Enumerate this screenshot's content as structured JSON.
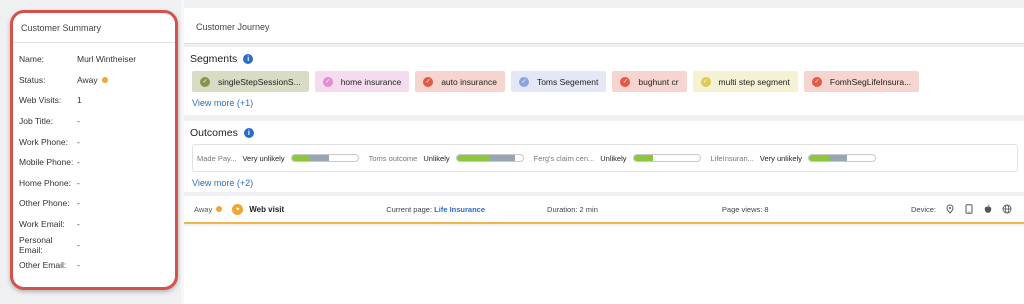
{
  "summary": {
    "title": "Customer Summary",
    "rows": [
      {
        "label": "Name:",
        "value": "Murl Wintheiser"
      },
      {
        "label": "Status:",
        "value": "Away"
      },
      {
        "label": "Web Visits:",
        "value": "1"
      },
      {
        "label": "Job Title:",
        "value": "-"
      },
      {
        "label": "Work Phone:",
        "value": "-"
      },
      {
        "label": "Mobile Phone:",
        "value": "-"
      },
      {
        "label": "Home Phone:",
        "value": "-"
      },
      {
        "label": "Other Phone:",
        "value": "-"
      },
      {
        "label": "Work Email:",
        "value": "-"
      },
      {
        "label": "Personal Email:",
        "value": "-"
      },
      {
        "label": "Other Email:",
        "value": "-"
      }
    ],
    "status_color": "#f2a531"
  },
  "journey": {
    "title": "Customer Journey"
  },
  "segments": {
    "title": "Segments",
    "chips": [
      {
        "label": "singleStepSessionS...",
        "bg": "#d9dcc4",
        "icon_color": "#8a9150"
      },
      {
        "label": "home insurance",
        "bg": "#f4dcee",
        "icon_color": "#e58bd2"
      },
      {
        "label": "auto insurance",
        "bg": "#f6d4cf",
        "icon_color": "#e05a44"
      },
      {
        "label": "Toms Segement",
        "bg": "#e4e8f6",
        "icon_color": "#8da3e0"
      },
      {
        "label": "bughunt cr",
        "bg": "#f6d4cf",
        "icon_color": "#e05a44"
      },
      {
        "label": "multi step segment",
        "bg": "#f5f1d3",
        "icon_color": "#dccb58"
      },
      {
        "label": "FomhSegLifeInsura...",
        "bg": "#f6d4cf",
        "icon_color": "#e05a44"
      }
    ],
    "view_more": "View more (+1)"
  },
  "outcomes": {
    "title": "Outcomes",
    "items": [
      {
        "name": "Made Pay...",
        "level": "Very unlikely",
        "green": 0.28,
        "gray": 0.28
      },
      {
        "name": "Toms outcome",
        "level": "Unlikely",
        "green": 0.5,
        "gray": 0.38
      },
      {
        "name": "Ferg's claim cen...",
        "level": "Unlikely",
        "green": 0.3,
        "gray": 0
      },
      {
        "name": "LifeInsuran...",
        "level": "Very unlikely",
        "green": 0.3,
        "gray": 0.28
      }
    ],
    "view_more": "View more (+2)"
  },
  "visit": {
    "status": "Away",
    "type": "Web visit",
    "current_page_label": "Current page:",
    "current_page": "Life Insurance",
    "duration": "Duration: 2 min",
    "page_views": "Page views: 8",
    "device_label": "Device:",
    "device_icons": [
      "location-pin-icon",
      "tablet-icon",
      "apple-icon",
      "globe-icon"
    ]
  }
}
